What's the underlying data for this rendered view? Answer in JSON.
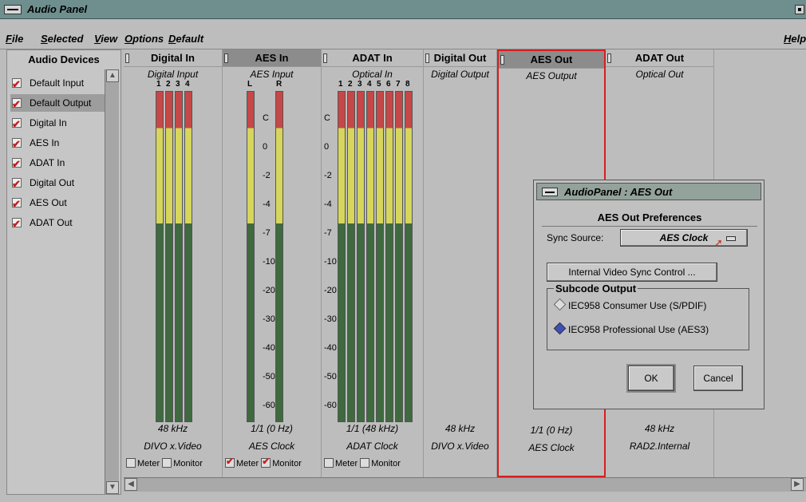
{
  "window": {
    "title": "Audio Panel"
  },
  "menubar": {
    "items": [
      {
        "label": "File",
        "accel": "F"
      },
      {
        "label": "Selected",
        "accel": "S"
      },
      {
        "label": "View",
        "accel": "V"
      },
      {
        "label": "Options",
        "accel": "O"
      },
      {
        "label": "Default",
        "accel": "D"
      }
    ],
    "help": "Help"
  },
  "devices": {
    "title": "Audio Devices",
    "items": [
      "Default Input",
      "Default Output",
      "Digital In",
      "AES In",
      "ADAT In",
      "Digital Out",
      "AES Out",
      "ADAT Out"
    ],
    "selected": "Default Output"
  },
  "channels": [
    {
      "name": "Digital In",
      "sub": "Digital Input",
      "freq": "48 kHz",
      "clock": "DIVO x.Video",
      "meter": "Meter",
      "monitor": "Monitor",
      "meter_on": false,
      "monitor_on": false,
      "labels": [
        "1",
        "2",
        "3",
        "4"
      ]
    },
    {
      "name": "AES In",
      "sub": "AES Input",
      "freq": "1/1 (0 Hz)",
      "clock": "AES Clock",
      "meter": "Meter",
      "monitor": "Monitor",
      "meter_on": true,
      "monitor_on": true,
      "labels": [
        "L",
        "R"
      ]
    },
    {
      "name": "ADAT In",
      "sub": "Optical In",
      "freq": "1/1 (48 kHz)",
      "clock": "ADAT Clock",
      "meter": "Meter",
      "monitor": "Monitor",
      "meter_on": false,
      "monitor_on": false,
      "labels": [
        "1",
        "2",
        "3",
        "4",
        "5",
        "6",
        "7",
        "8"
      ]
    },
    {
      "name": "Digital Out",
      "sub": "Digital Output",
      "freq": "48 kHz",
      "clock": "DIVO x.Video"
    },
    {
      "name": "AES Out",
      "sub": "AES Output",
      "freq": "1/1 (0 Hz)",
      "clock": "AES Clock"
    },
    {
      "name": "ADAT Out",
      "sub": "Optical Out",
      "freq": "48 kHz",
      "clock": "RAD2.Internal"
    }
  ],
  "scale": [
    "C",
    "0",
    "-2",
    "-4",
    "-7",
    "-10",
    "-20",
    "-30",
    "-40",
    "-50",
    "-60"
  ],
  "dialog": {
    "title": "AudioPanel : AES Out",
    "heading": "AES Out Preferences",
    "sync_label": "Sync Source:",
    "sync_value": "AES Clock",
    "internal_button": "Internal Video Sync Control ...",
    "subcode_title": "Subcode Output",
    "options": [
      "IEC958 Consumer Use (S/PDIF)",
      "IEC958 Professional Use (AES3)"
    ],
    "selected_option": 1,
    "ok": "OK",
    "cancel": "Cancel"
  }
}
